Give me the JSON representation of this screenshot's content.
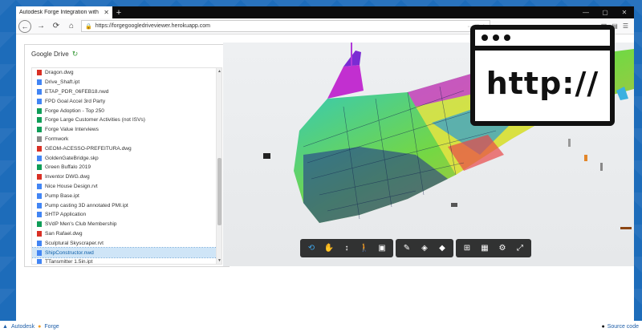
{
  "tab": {
    "title": "Autodesk Forge Integration with G",
    "close": "✕",
    "new": "+"
  },
  "window_controls": [
    "—",
    "▢",
    "✕"
  ],
  "nav": {
    "back": "←",
    "forward": "→",
    "reload": "⟳",
    "home": "⌂",
    "url": "https://forgegoogledriveviewer.herokuapp.com",
    "url_right": "··· ♡ ☆"
  },
  "drive": {
    "title": "Google Drive",
    "files": [
      {
        "name": "Dragon.dwg",
        "color": "#d93025"
      },
      {
        "name": "Drive_Shaft.ipt",
        "color": "#4285f4"
      },
      {
        "name": "ETAP_PDR_06FEB18.nwd",
        "color": "#4285f4"
      },
      {
        "name": "FPD Goal Accel 3rd Party",
        "color": "#4285f4"
      },
      {
        "name": "Forge Adoption - Top 250",
        "color": "#0f9d58"
      },
      {
        "name": "Forge Large Customer Activities (not ISVs)",
        "color": "#0f9d58"
      },
      {
        "name": "Forge Value Interviews",
        "color": "#0f9d58"
      },
      {
        "name": "Formwork",
        "color": "#8a8a8a"
      },
      {
        "name": "GEOM-ACESSO-PREFEITURA.dwg",
        "color": "#d93025"
      },
      {
        "name": "GoldenGateBridge.skp",
        "color": "#4285f4"
      },
      {
        "name": "Green Buffalo 2019",
        "color": "#0f9d58"
      },
      {
        "name": "Inventor DWG.dwg",
        "color": "#d93025"
      },
      {
        "name": "Nice House Design.rvt",
        "color": "#4285f4"
      },
      {
        "name": "Pump Base.ipt",
        "color": "#4285f4"
      },
      {
        "name": "Pump casting 3D annotated PMI.ipt",
        "color": "#4285f4"
      },
      {
        "name": "SHTP Application",
        "color": "#4285f4"
      },
      {
        "name": "SVdP Men's Club Membership",
        "color": "#0f9d58"
      },
      {
        "name": "San Rafael.dwg",
        "color": "#d93025"
      },
      {
        "name": "Sculptural Skyscraper.rvt",
        "color": "#4285f4"
      },
      {
        "name": "ShipConstructor.nwd",
        "color": "#4285f4",
        "selected": true
      },
      {
        "name": "TTansmitter 1.5in.ipt",
        "color": "#4285f4"
      }
    ]
  },
  "http_card": {
    "text": "http://"
  },
  "footer": {
    "left1": "Autodesk",
    "left2": "Forge",
    "right": "Source code"
  }
}
